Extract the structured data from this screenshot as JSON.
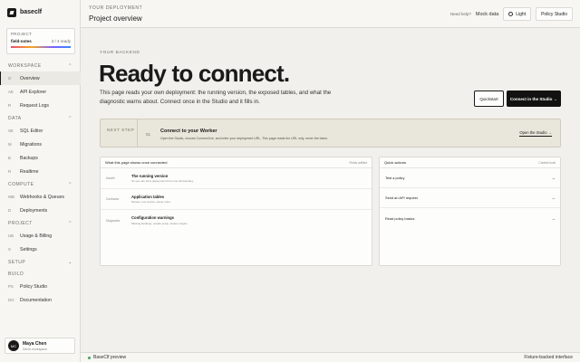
{
  "brand": {
    "name": "baseclf"
  },
  "project": {
    "label": "PROJECT",
    "name": "field-notes",
    "ready": "3 / 4 ready"
  },
  "nav": {
    "workspace": {
      "label": "WORKSPACE",
      "items": [
        {
          "abbr": "O",
          "label": "Overview"
        },
        {
          "abbr": "AE",
          "label": "API Explorer"
        },
        {
          "abbr": "R",
          "label": "Request Logs"
        }
      ]
    },
    "data": {
      "label": "DATA",
      "items": [
        {
          "abbr": "SE",
          "label": "SQL Editor"
        },
        {
          "abbr": "M",
          "label": "Migrations"
        },
        {
          "abbr": "B",
          "label": "Backups"
        },
        {
          "abbr": "R",
          "label": "Realtime"
        }
      ]
    },
    "compute": {
      "label": "COMPUTE",
      "items": [
        {
          "abbr": "WB",
          "label": "Webhooks & Queues"
        },
        {
          "abbr": "D",
          "label": "Deployments"
        }
      ]
    },
    "project": {
      "label": "PROJECT",
      "items": [
        {
          "abbr": "UB",
          "label": "Usage & Billing"
        },
        {
          "abbr": "S",
          "label": "Settings"
        }
      ]
    },
    "setup": {
      "label": "SETUP"
    },
    "build": {
      "label": "BUILD",
      "items": [
        {
          "abbr": "PS",
          "label": "Policy Studio"
        },
        {
          "abbr": "DO",
          "label": "Documentation"
        }
      ]
    }
  },
  "user": {
    "initials": "MC",
    "name": "Maya Chen",
    "role": "Demo workspace"
  },
  "header": {
    "crumb": "YOUR DEPLOYMENT",
    "title": "Project overview",
    "need_help": "Need help?",
    "mock_data": "Mock data",
    "light_label": "Light",
    "policy_label": "Policy Studio"
  },
  "main": {
    "section_label": "YOUR BACKEND",
    "hero": "Ready to connect.",
    "description": "This page reads your own deployment: the running version, the exposed tables, and what the diagnostic warns about. Connect once in the Studio and it fills in.",
    "quickstart": "Quickstart",
    "connect": "Connect in the Studio →"
  },
  "next_step": {
    "label": "NEXT STEP",
    "number": "01",
    "title": "Connect to your Worker",
    "description": "Open the Studio, choose Connect live, and enter your deployment URL. This page reads the URL only, never the token.",
    "link": "Open the Studio →"
  },
  "shows": {
    "title": "What this page shows once connected",
    "meta": "Fields unfilled",
    "rows": [
      {
        "key": "Health",
        "title": "The running version",
        "desc": "So you can tell a deployment from one still pending."
      },
      {
        "key": "Contracts",
        "title": "Application tables",
        "desc": "Names, row counts, owner roles."
      },
      {
        "key": "Diagnostic",
        "title": "Configuration warnings",
        "desc": "Missing bindings, unsafe setup, broken origins."
      }
    ]
  },
  "quick_actions": {
    "title": "Quick actions",
    "meta": "Context tools",
    "rows": [
      {
        "label": "Test a policy",
        "arrow": "→"
      },
      {
        "label": "Send an API request",
        "arrow": "→"
      },
      {
        "label": "Read policy basics",
        "arrow": "→"
      }
    ]
  },
  "footer": {
    "left": "BaseClf preview",
    "right": "Fixture-backed interface"
  },
  "colors": {
    "accent": "#121211",
    "status": "#3aa55c",
    "next_step_bg": "#e9e6db"
  }
}
